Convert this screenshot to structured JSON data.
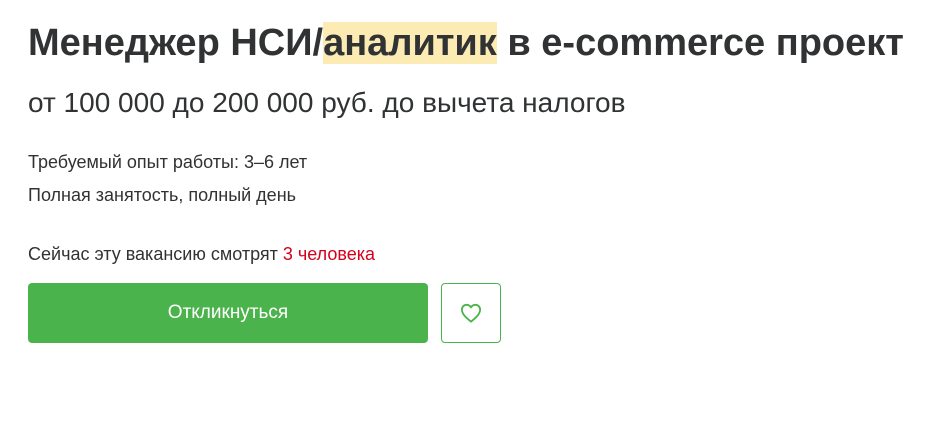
{
  "vacancy": {
    "title_prefix": "Менеджер НСИ/",
    "title_highlight": "аналитик",
    "title_suffix": " в e-commerce проект",
    "salary": "от 100 000 до 200 000 руб. до вычета налогов",
    "experience": "Требуемый опыт работы: 3–6 лет",
    "employment": "Полная занятость, полный день",
    "watchers_text": "Сейчас эту вакансию смотрят ",
    "watchers_count": "3 человека"
  },
  "actions": {
    "respond_label": "Откликнуться",
    "favorite_icon": "heart-icon"
  },
  "colors": {
    "accent": "#4bb34b",
    "highlight": "#fcecb3",
    "watchers_count": "#d6001c",
    "text": "#303233"
  }
}
